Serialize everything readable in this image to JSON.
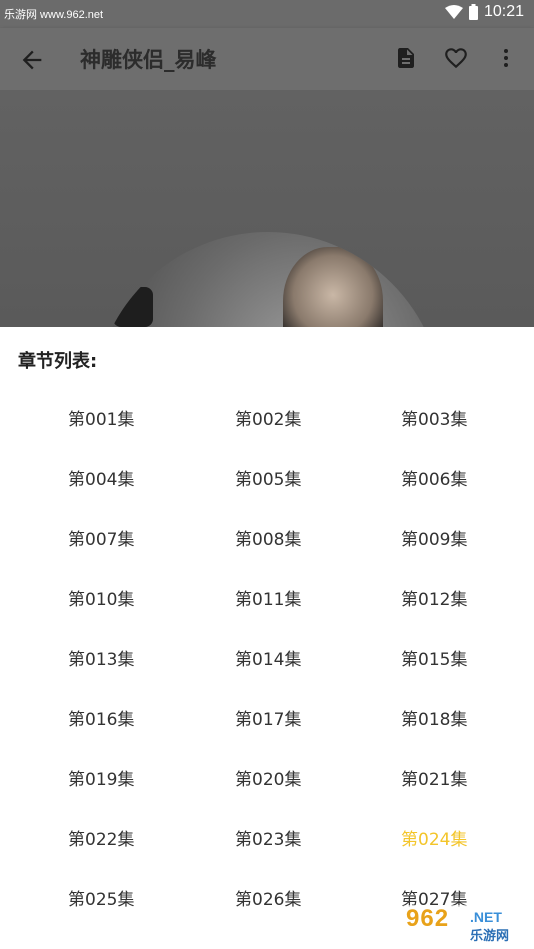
{
  "status_bar": {
    "watermark": "乐游网 www.962.net",
    "time": "10:21"
  },
  "app_bar": {
    "title": "神雕侠侣_易峰",
    "icons": [
      "back-arrow-icon",
      "document-icon",
      "heart-icon",
      "more-vert-icon"
    ]
  },
  "sheet": {
    "title": "章节列表:",
    "episodes": [
      "第001集",
      "第002集",
      "第003集",
      "第004集",
      "第005集",
      "第006集",
      "第007集",
      "第008集",
      "第009集",
      "第010集",
      "第011集",
      "第012集",
      "第013集",
      "第014集",
      "第015集",
      "第016集",
      "第017集",
      "第018集",
      "第019集",
      "第020集",
      "第021集",
      "第022集",
      "第023集",
      "第024集",
      "第025集",
      "第026集",
      "第027集"
    ],
    "active_episode": "第024集",
    "active_color": "#f3c52a"
  },
  "logo": {
    "big": "962",
    "net": ".NET",
    "small": "乐游网"
  }
}
